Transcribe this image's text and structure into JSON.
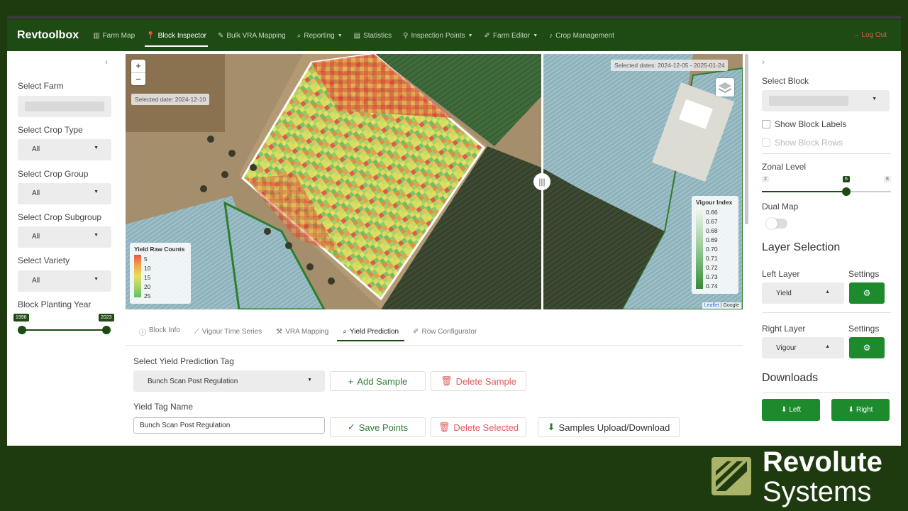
{
  "app": {
    "title": "Revtoolbox",
    "logout": "Log Out"
  },
  "nav": [
    {
      "label": "Farm Map",
      "icon": "map-icon"
    },
    {
      "label": "Block Inspector",
      "icon": "pin-icon",
      "active": true
    },
    {
      "label": "Bulk VRA Mapping",
      "icon": "pencil-icon"
    },
    {
      "label": "Reporting",
      "icon": "search-icon",
      "dropdown": true
    },
    {
      "label": "Statistics",
      "icon": "chart-icon"
    },
    {
      "label": "Inspection Points",
      "icon": "pin-icon",
      "dropdown": true
    },
    {
      "label": "Farm Editor",
      "icon": "edit-icon",
      "dropdown": true
    },
    {
      "label": "Crop Management",
      "icon": "bell-icon"
    }
  ],
  "left_sidebar": {
    "select_farm": "Select Farm",
    "select_crop_type": "Select Crop Type",
    "crop_type_value": "All",
    "select_crop_group": "Select Crop Group",
    "crop_group_value": "All",
    "select_crop_subgroup": "Select Crop Subgroup",
    "crop_subgroup_value": "All",
    "select_variety": "Select Variety",
    "variety_value": "All",
    "planting_year_label": "Block Planting Year",
    "year_min": "1996",
    "year_max": "2023"
  },
  "map": {
    "zoom_in": "+",
    "zoom_out": "−",
    "left_date": "Selected date: 2024-12-10",
    "right_dates": "Selected dates: 2024-12-05 - 2025-01-24",
    "left_legend": {
      "title": "Yield Raw Counts",
      "values": [
        "5",
        "10",
        "15",
        "20",
        "25"
      ],
      "colors": [
        "#e4574b",
        "#f0a54a",
        "#e8e05a",
        "#a6d46a",
        "#5cbf63"
      ]
    },
    "right_legend": {
      "title": "Vigour Index",
      "values": [
        "0.66",
        "0.67",
        "0.68",
        "0.69",
        "0.70",
        "0.71",
        "0.72",
        "0.73",
        "0.74"
      ],
      "colors": [
        "#f2f7f2",
        "#e0efe0",
        "#cbe5cb",
        "#b2d8b2",
        "#98cb98",
        "#7ebe7e",
        "#64b064",
        "#4a9f4a",
        "#358c35"
      ]
    },
    "attribution_link": "Leaflet",
    "attribution_text": " | Google"
  },
  "tabs": [
    {
      "label": "Block Info",
      "icon": "info-icon"
    },
    {
      "label": "Vigour Time Series",
      "icon": "line-chart-icon"
    },
    {
      "label": "VRA Mapping",
      "icon": "vra-icon"
    },
    {
      "label": "Yield Prediction",
      "icon": "search-icon",
      "active": true
    },
    {
      "label": "Row Configurator",
      "icon": "edit-icon"
    }
  ],
  "yield": {
    "tag_label": "Select Yield Prediction Tag",
    "tag_value": "Bunch Scan Post Regulation",
    "add_sample": "Add Sample",
    "delete_sample": "Delete Sample",
    "name_label": "Yield Tag Name",
    "name_value": "Bunch Scan Post Regulation",
    "save_points": "Save Points",
    "delete_selected": "Delete Selected",
    "samples_upload": "Samples Upload/Download"
  },
  "right_sidebar": {
    "select_block": "Select Block",
    "show_block_labels": "Show Block Labels",
    "show_block_rows": "Show Block Rows",
    "zonal_level": "Zonal Level",
    "zonal_min": "2",
    "zonal_value": "6",
    "zonal_max": "8",
    "dual_map": "Dual Map",
    "layer_selection": "Layer Selection",
    "left_layer": "Left Layer",
    "left_layer_value": "Yield",
    "right_layer": "Right Layer",
    "right_layer_value": "Vigour",
    "settings": "Settings",
    "downloads": "Downloads",
    "download_left": "Left",
    "download_right": "Right"
  },
  "branding": {
    "name": "Revolute",
    "sub": "Systems"
  }
}
